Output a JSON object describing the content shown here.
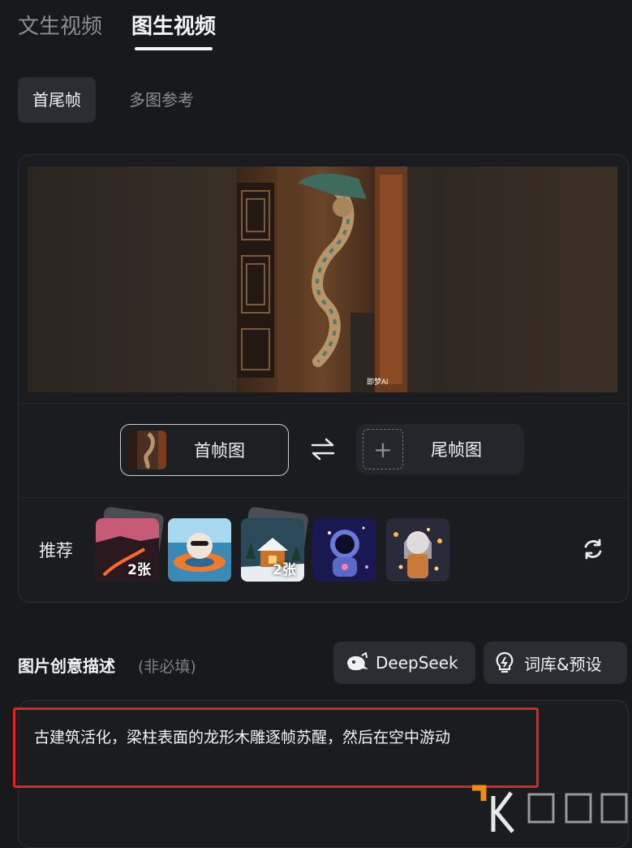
{
  "tabs": [
    {
      "label": "文生视频",
      "active": false
    },
    {
      "label": "图生视频",
      "active": true
    }
  ],
  "subtabs": [
    {
      "label": "首尾帧",
      "active": true
    },
    {
      "label": "多图参考",
      "active": false
    }
  ],
  "preview": {
    "watermark": "即梦AI"
  },
  "frames": {
    "first_label": "首帧图",
    "last_label": "尾帧图",
    "swap_icon": "swap-arrows-icon",
    "add_icon": "plus-icon"
  },
  "recommend": {
    "label": "推荐",
    "items": [
      {
        "name": "lava-landscape",
        "badge": "2张"
      },
      {
        "name": "bear-float",
        "badge": ""
      },
      {
        "name": "snow-house",
        "badge": "2张"
      },
      {
        "name": "astronaut",
        "badge": ""
      },
      {
        "name": "sparkle-girl",
        "badge": ""
      }
    ],
    "refresh_icon": "refresh-icon"
  },
  "description": {
    "title": "图片创意描述",
    "optional": "(非必填)",
    "deepseek_label": "DeepSeek",
    "library_label": "词库&预设",
    "prompt_text": "古建筑活化，梁柱表面的龙形木雕逐帧苏醒，然后在空中游动"
  },
  "colors": {
    "background": "#17191c",
    "highlight_border": "#e0241d",
    "watermark_orange": "#f08a1a"
  }
}
